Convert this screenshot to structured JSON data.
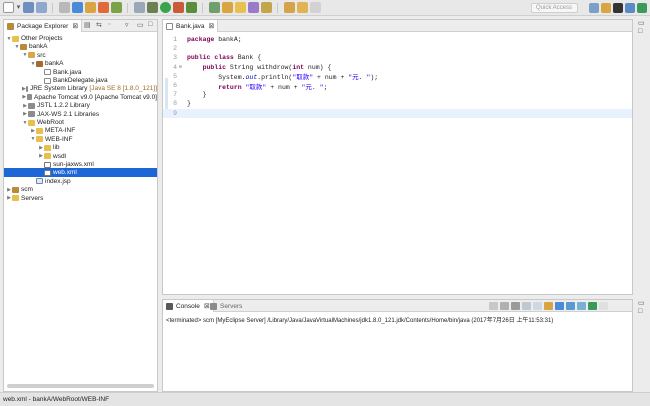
{
  "toolbar": {
    "quick_access_placeholder": "Quick Access"
  },
  "package_explorer": {
    "tab_label": "Package Explorer",
    "tree": [
      {
        "label": "Other Projects",
        "decor": "",
        "icon": "folder-icon",
        "level": 0,
        "expanded": true
      },
      {
        "label": "bankA",
        "decor": "",
        "icon": "project-icon",
        "level": 1,
        "expanded": true
      },
      {
        "label": "src",
        "decor": "",
        "icon": "source-folder-icon",
        "level": 2,
        "expanded": true
      },
      {
        "label": "bankA",
        "decor": "",
        "icon": "package-icon",
        "level": 3,
        "expanded": true
      },
      {
        "label": "Bank.java",
        "decor": "",
        "icon": "java-file-icon",
        "level": 4,
        "expanded": false
      },
      {
        "label": "BankDelegate.java",
        "decor": "",
        "icon": "java-file-icon",
        "level": 4,
        "expanded": false
      },
      {
        "label": "JRE System Library",
        "decor": "[Java SE 8 [1.8.0_121]]",
        "icon": "library-icon",
        "level": 2,
        "expanded": false
      },
      {
        "label": "Apache Tomcat v9.0 [Apache Tomcat v9.0]",
        "decor": "",
        "icon": "library-icon",
        "level": 2,
        "expanded": false
      },
      {
        "label": "JSTL 1.2.2 Library",
        "decor": "",
        "icon": "library-icon",
        "level": 2,
        "expanded": false
      },
      {
        "label": "JAX-WS 2.1 Libraries",
        "decor": "",
        "icon": "library-icon",
        "level": 2,
        "expanded": false
      },
      {
        "label": "WebRoot",
        "decor": "",
        "icon": "folder-icon",
        "level": 2,
        "expanded": true
      },
      {
        "label": "META-INF",
        "decor": "",
        "icon": "folder-icon",
        "level": 3,
        "expanded": false
      },
      {
        "label": "WEB-INF",
        "decor": "",
        "icon": "folder-icon",
        "level": 3,
        "expanded": true
      },
      {
        "label": "lib",
        "decor": "",
        "icon": "folder-icon",
        "level": 4,
        "expanded": false
      },
      {
        "label": "wsdl",
        "decor": "",
        "icon": "folder-icon",
        "level": 4,
        "expanded": false
      },
      {
        "label": "sun-jaxws.xml",
        "decor": "",
        "icon": "xml-file-icon",
        "level": 4,
        "expanded": false
      },
      {
        "label": "web.xml",
        "decor": "",
        "icon": "xml-file-icon",
        "level": 4,
        "expanded": false,
        "selected": true
      },
      {
        "label": "index.jsp",
        "decor": "",
        "icon": "jsp-file-icon",
        "level": 3,
        "expanded": false
      },
      {
        "label": "scm",
        "decor": "",
        "icon": "project-icon",
        "level": 0,
        "expanded": false
      },
      {
        "label": "Servers",
        "decor": "",
        "icon": "folder-icon",
        "level": 0,
        "expanded": false
      }
    ]
  },
  "editor": {
    "tab_label": "Bank.java",
    "current_line": 9,
    "lines": [
      {
        "n": "1",
        "tokens": [
          {
            "t": "kw",
            "v": "package"
          },
          {
            "t": "",
            "v": " bankA;"
          }
        ]
      },
      {
        "n": "2",
        "tokens": []
      },
      {
        "n": "3",
        "tokens": [
          {
            "t": "kw",
            "v": "public"
          },
          {
            "t": "",
            "v": " "
          },
          {
            "t": "kw",
            "v": "class"
          },
          {
            "t": "",
            "v": " Bank {"
          }
        ]
      },
      {
        "n": "4",
        "marker": "⊖",
        "tokens": [
          {
            "t": "",
            "v": "    "
          },
          {
            "t": "kw",
            "v": "public"
          },
          {
            "t": "",
            "v": " String withdrow("
          },
          {
            "t": "kw",
            "v": "int"
          },
          {
            "t": "",
            "v": " num) {"
          }
        ]
      },
      {
        "n": "5",
        "tokens": [
          {
            "t": "",
            "v": "        System."
          },
          {
            "t": "fld",
            "v": "out"
          },
          {
            "t": "",
            "v": ".println("
          },
          {
            "t": "str",
            "v": "\"取款\""
          },
          {
            "t": "",
            "v": " + num + "
          },
          {
            "t": "str",
            "v": "\"元. \""
          },
          {
            "t": "",
            "v": ");"
          }
        ]
      },
      {
        "n": "6",
        "tokens": [
          {
            "t": "",
            "v": "        "
          },
          {
            "t": "kw",
            "v": "return"
          },
          {
            "t": "",
            "v": " "
          },
          {
            "t": "str",
            "v": "\"取款\""
          },
          {
            "t": "",
            "v": " + num + "
          },
          {
            "t": "str",
            "v": "\"元. \""
          },
          {
            "t": "",
            "v": ";"
          }
        ]
      },
      {
        "n": "7",
        "tokens": [
          {
            "t": "",
            "v": "    }"
          }
        ]
      },
      {
        "n": "8",
        "tokens": [
          {
            "t": "",
            "v": "}"
          }
        ]
      },
      {
        "n": "9",
        "tokens": []
      }
    ]
  },
  "bottom_panel": {
    "console_tab": "Console",
    "servers_tab": "Servers",
    "console_text": "<terminated> scm [MyEclipse Server] /Library/Java/JavaVirtualMachines/jdk1.8.0_121.jdk/Contents/Home/bin/java (2017年7月26日 上午11:53:31)"
  },
  "status_bar": {
    "text": "web.xml - bankA/WebRoot/WEB-INF"
  },
  "colors": {
    "selection": "#1c66d6",
    "keyword": "#7f0055",
    "string": "#2a00ff",
    "field": "#0000c0",
    "current_line": "#e8f2fe"
  }
}
